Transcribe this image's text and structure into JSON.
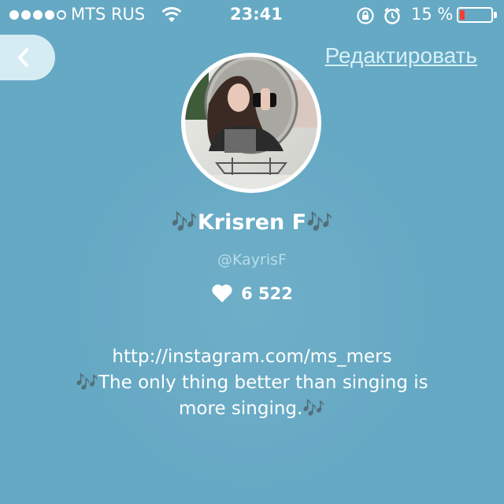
{
  "status_bar": {
    "carrier": "MTS RUS",
    "time": "23:41",
    "battery_percent": "15 %",
    "battery_level": 0.15,
    "signal_bars_filled": 4,
    "signal_bars_total": 5
  },
  "nav": {
    "back_icon": "chevron-left-icon",
    "edit_label": "Редактировать"
  },
  "profile": {
    "display_name": "🎶Krisren F🎶",
    "username": "@KayrisF",
    "likes_count": "6 522",
    "bio": {
      "line1": "http://instagram.com/ms_mers",
      "line2": "🎶The only thing better than singing is",
      "line3": "more singing.🎶"
    }
  },
  "colors": {
    "background": "#66a9c4",
    "back_button_bg": "#d5ecf3",
    "edit_link": "#d7f0f8",
    "battery_low": "#ff3b30"
  }
}
